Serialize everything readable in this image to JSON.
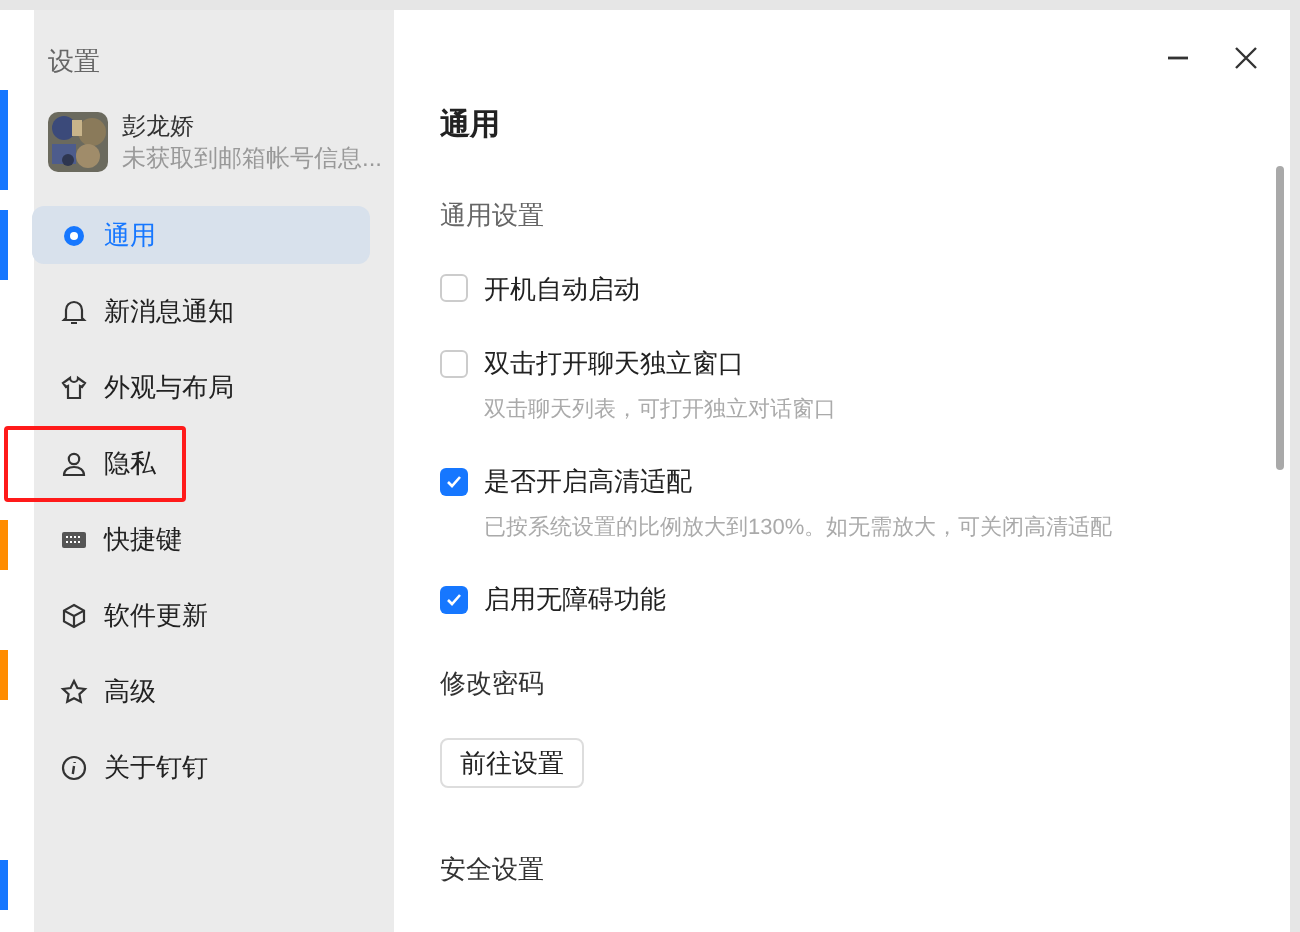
{
  "sidebar": {
    "title": "设置",
    "profile": {
      "name": "彭龙娇",
      "email": "未获取到邮箱帐号信息..."
    },
    "items": [
      {
        "label": "通用",
        "selected": true,
        "annotated": false
      },
      {
        "label": "新消息通知",
        "selected": false,
        "annotated": false
      },
      {
        "label": "外观与布局",
        "selected": false,
        "annotated": false
      },
      {
        "label": "隐私",
        "selected": false,
        "annotated": true
      },
      {
        "label": "快捷键",
        "selected": false,
        "annotated": false
      },
      {
        "label": "软件更新",
        "selected": false,
        "annotated": false
      },
      {
        "label": "高级",
        "selected": false,
        "annotated": false
      },
      {
        "label": "关于钉钉",
        "selected": false,
        "annotated": false
      }
    ]
  },
  "main": {
    "title": "通用",
    "sections": [
      {
        "kind": "heading",
        "text": "通用设置",
        "muted": true
      },
      {
        "kind": "checkbox",
        "label": "开机自动启动",
        "checked": false
      },
      {
        "kind": "checkbox",
        "label": "双击打开聊天独立窗口",
        "checked": false,
        "description": "双击聊天列表，可打开独立对话窗口"
      },
      {
        "kind": "checkbox",
        "label": "是否开启高清适配",
        "checked": true,
        "description": "已按系统设置的比例放大到130%。如无需放大，可关闭高清适配"
      },
      {
        "kind": "checkbox",
        "label": "启用无障碍功能",
        "checked": true
      },
      {
        "kind": "heading",
        "text": "修改密码",
        "muted": false
      },
      {
        "kind": "button",
        "label": "前往设置"
      },
      {
        "kind": "heading",
        "text": "安全设置",
        "muted": false
      }
    ]
  }
}
